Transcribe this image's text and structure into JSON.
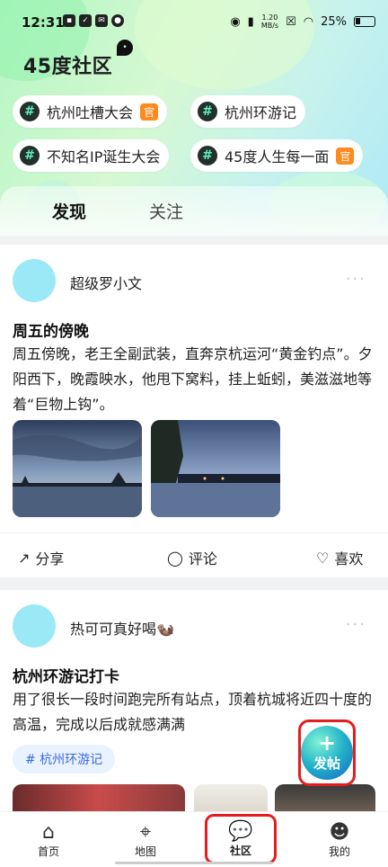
{
  "status_bar": {
    "time": "12:31",
    "network_speed_top": "1.20",
    "network_speed_unit": "MB/s",
    "battery": "25%"
  },
  "header": {
    "title": "45度社区"
  },
  "topics": [
    {
      "label": "杭州吐槽大会",
      "badge": "官"
    },
    {
      "label": "杭州环游记",
      "badge": ""
    },
    {
      "label": "不知名IP诞生大会",
      "badge": ""
    },
    {
      "label": "45度人生每一面",
      "badge": "官"
    }
  ],
  "tabs": {
    "discover": "发现",
    "follow": "关注"
  },
  "posts": [
    {
      "username": "超级罗小文",
      "title": "周五的傍晚",
      "body": "周五傍晚，老王全副武装，直奔京杭运河“黄金钓点”。夕阳西下，晚霞映水，他甩下窝料，挂上蚯蚓，美滋滋地等着“巨物上钩”。",
      "actions": {
        "share": "分享",
        "comment": "评论",
        "like": "喜欢"
      }
    },
    {
      "username": "热可可真好喝🦦",
      "title": "杭州环游记打卡",
      "body": "用了很长一段时间跑完所有站点，顶着杭城将近四十度的高温，完成以后成就感满满",
      "topic_chip": "# 杭州环游记"
    }
  ],
  "fab": {
    "plus": "+",
    "label": "发帖"
  },
  "bottom_nav": [
    {
      "label": "首页",
      "icon": "home-icon"
    },
    {
      "label": "地图",
      "icon": "map-pin-icon"
    },
    {
      "label": "社区",
      "icon": "chat-bubble-icon"
    },
    {
      "label": "我的",
      "icon": "profile-icon"
    }
  ],
  "colors": {
    "accent": "#0ac4b1",
    "highlight_red": "#e41d1d",
    "badge_orange": "#ff8a1e"
  }
}
